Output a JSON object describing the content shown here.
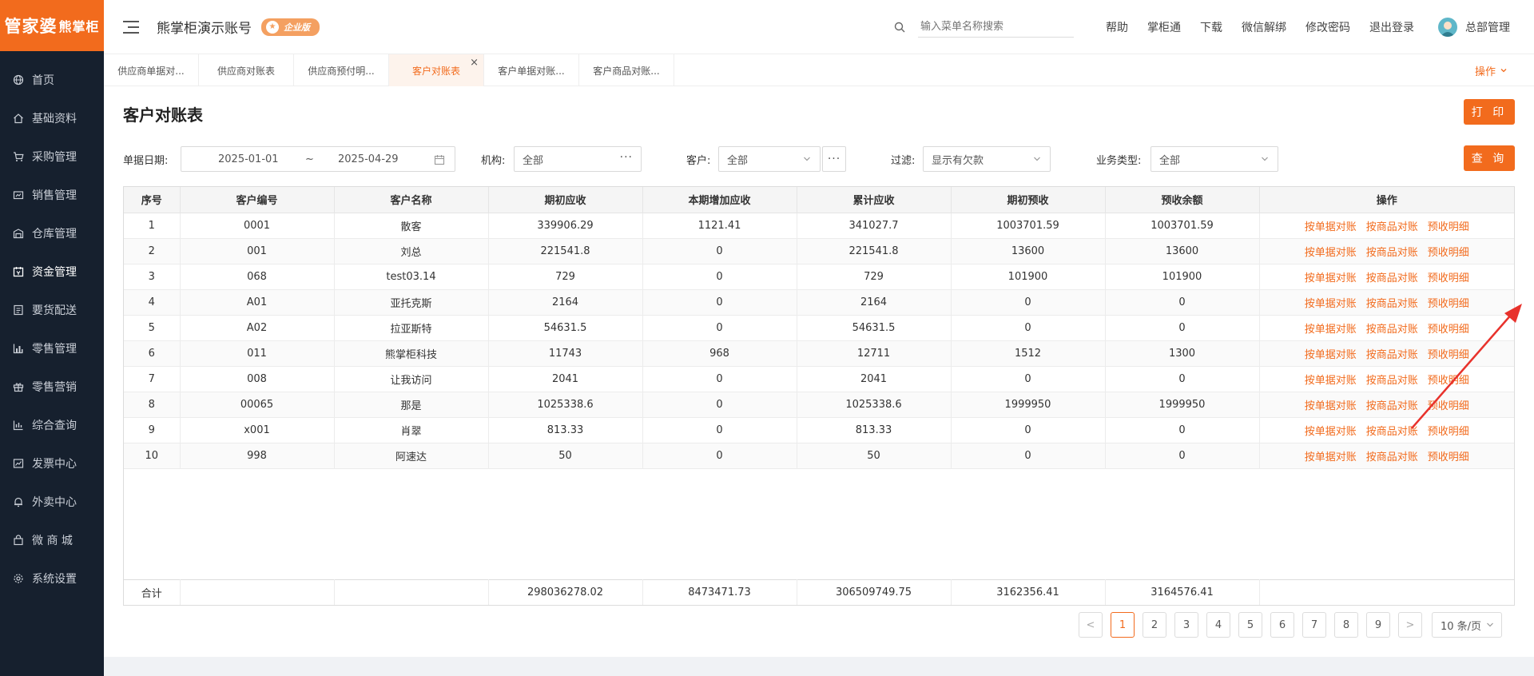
{
  "sidebar": {
    "logo_main": "管家婆",
    "logo_sub": "熊掌柜",
    "items": [
      {
        "label": "首页",
        "icon": "globe-icon"
      },
      {
        "label": "基础资料",
        "icon": "home-icon"
      },
      {
        "label": "采购管理",
        "icon": "cart-icon"
      },
      {
        "label": "销售管理",
        "icon": "sales-icon"
      },
      {
        "label": "仓库管理",
        "icon": "warehouse-icon"
      },
      {
        "label": "资金管理",
        "icon": "calendar-icon"
      },
      {
        "label": "要货配送",
        "icon": "list-icon"
      },
      {
        "label": "零售管理",
        "icon": "bar-chart-icon"
      },
      {
        "label": "零售营销",
        "icon": "gift-icon"
      },
      {
        "label": "综合查询",
        "icon": "chart-icon"
      },
      {
        "label": "发票中心",
        "icon": "line-chart-icon"
      },
      {
        "label": "外卖中心",
        "icon": "bell-icon"
      },
      {
        "label": "微 商 城",
        "icon": "bag-icon"
      },
      {
        "label": "系统设置",
        "icon": "gear-icon"
      }
    ],
    "active_index": 5
  },
  "header": {
    "account_title": "熊掌柜演示账号",
    "badge": "企业版",
    "search_placeholder": "输入菜单名称搜索",
    "links": [
      "帮助",
      "掌柜通",
      "下载",
      "微信解绑",
      "修改密码",
      "退出登录"
    ],
    "user_name": "总部管理"
  },
  "tabs": {
    "items": [
      "供应商单据对...",
      "供应商对账表",
      "供应商预付明...",
      "客户对账表",
      "客户单据对账...",
      "客户商品对账..."
    ],
    "active_index": 3,
    "ops_label": "操作"
  },
  "page": {
    "title": "客户对账表",
    "print_button": "打 印",
    "query_button": "查 询"
  },
  "filters": {
    "date_label": "单据日期:",
    "date_start": "2025-01-01",
    "date_sep": "~",
    "date_end": "2025-04-29",
    "org_label": "机构:",
    "org_value": "全部",
    "org_dots": "···",
    "customer_label": "客户:",
    "customer_value": "全部",
    "customer_dots": "···",
    "filter_label": "过滤:",
    "filter_value": "显示有欠款",
    "biz_type_label": "业务类型:",
    "biz_type_value": "全部"
  },
  "table": {
    "columns": [
      "序号",
      "客户编号",
      "客户名称",
      "期初应收",
      "本期增加应收",
      "累计应收",
      "期初预收",
      "预收余额",
      "操作"
    ],
    "rows": [
      [
        "1",
        "0001",
        "散客",
        "339906.29",
        "1121.41",
        "341027.7",
        "1003701.59",
        "1003701.59"
      ],
      [
        "2",
        "001",
        "刘总",
        "221541.8",
        "0",
        "221541.8",
        "13600",
        "13600"
      ],
      [
        "3",
        "068",
        "test03.14",
        "729",
        "0",
        "729",
        "101900",
        "101900"
      ],
      [
        "4",
        "A01",
        "亚托克斯",
        "2164",
        "0",
        "2164",
        "0",
        "0"
      ],
      [
        "5",
        "A02",
        "拉亚斯特",
        "54631.5",
        "0",
        "54631.5",
        "0",
        "0"
      ],
      [
        "6",
        "011",
        "熊掌柜科技",
        "11743",
        "968",
        "12711",
        "1512",
        "1300"
      ],
      [
        "7",
        "008",
        "让我访问",
        "2041",
        "0",
        "2041",
        "0",
        "0"
      ],
      [
        "8",
        "00065",
        "那是",
        "1025338.6",
        "0",
        "1025338.6",
        "1999950",
        "1999950"
      ],
      [
        "9",
        "x001",
        "肖翠",
        "813.33",
        "0",
        "813.33",
        "0",
        "0"
      ],
      [
        "10",
        "998",
        "阿速达",
        "50",
        "0",
        "50",
        "0",
        "0"
      ]
    ],
    "row_actions": [
      "按单据对账",
      "按商品对账",
      "预收明细"
    ],
    "summary": [
      "合计",
      "",
      "",
      "298036278.02",
      "8473471.73",
      "306509749.75",
      "3162356.41",
      "3164576.41",
      ""
    ]
  },
  "pagination": {
    "pages": [
      "1",
      "2",
      "3",
      "4",
      "5",
      "6",
      "7",
      "8",
      "9"
    ],
    "current": "1",
    "prev": "<",
    "next": ">",
    "page_size": "10 条/页"
  },
  "colors": {
    "accent": "#f26b1d",
    "sidebar_bg": "#16202e",
    "annotation_arrow": "#e8322c"
  }
}
